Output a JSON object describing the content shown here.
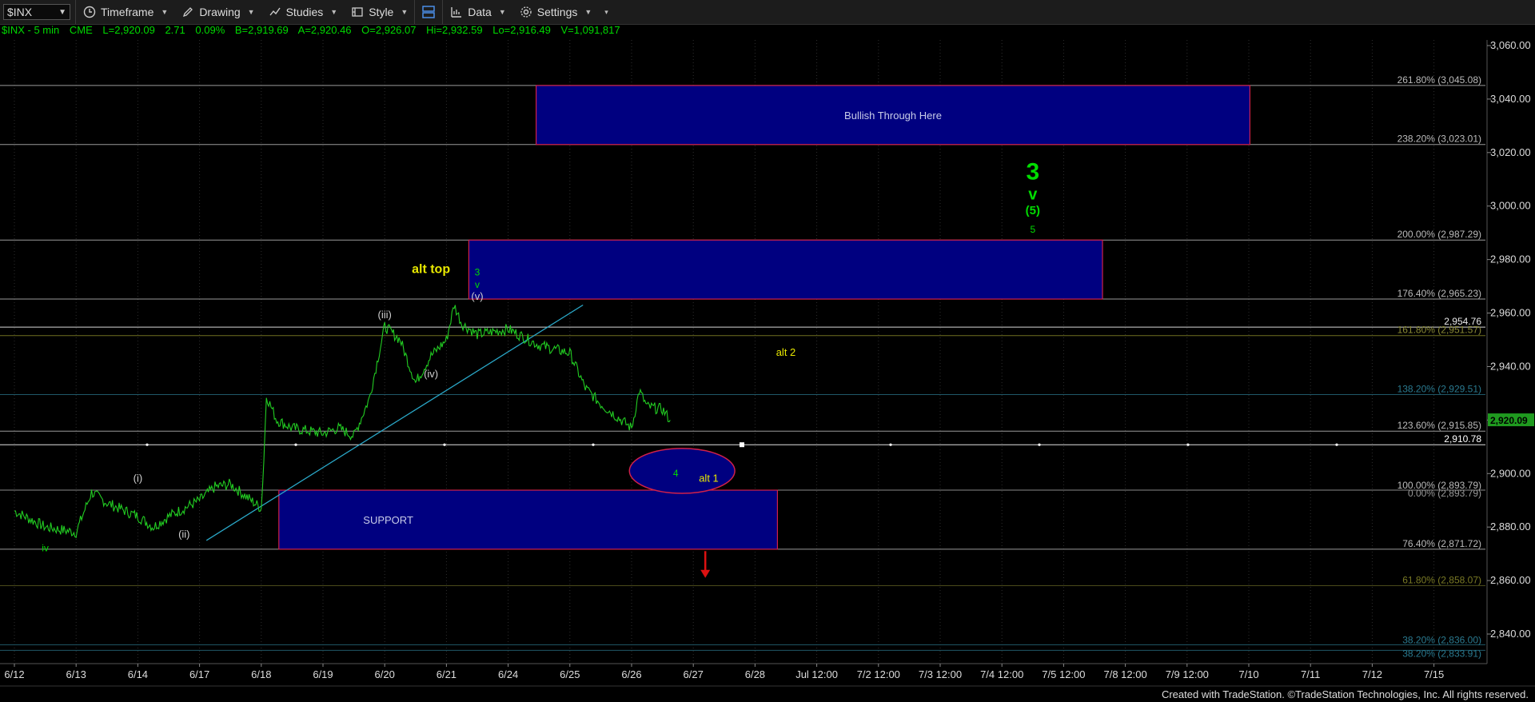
{
  "toolbar": {
    "symbol": "$INX",
    "timeframe": "Timeframe",
    "drawing": "Drawing",
    "studies": "Studies",
    "style": "Style",
    "data": "Data",
    "settings": "Settings"
  },
  "quote": {
    "name": "$INX - 5 min",
    "exchange": "CME",
    "last": "L=2,920.09",
    "change": "2.71",
    "pct": "0.09%",
    "bid": "B=2,919.69",
    "ask": "A=2,920.46",
    "open": "O=2,926.07",
    "high": "Hi=2,932.59",
    "low": "Lo=2,916.49",
    "volume": "V=1,091,817"
  },
  "colors": {
    "price": "#22cc22",
    "box_fill": "#000080",
    "box_border": "#d0204a",
    "trendline": "#2aa8c8",
    "up_text": "#00dd00",
    "alt_text": "#e8e800",
    "down_arrow": "#dd1111"
  },
  "footer": "Created with TradeStation. ©TradeStation Technologies, Inc. All rights reserved.",
  "chart_data": {
    "type": "line",
    "title": "$INX - 5 min",
    "xlabel": "",
    "ylabel": "",
    "x_tick_labels": [
      "6/12",
      "6/13",
      "6/14",
      "6/17",
      "6/18",
      "6/19",
      "6/20",
      "6/21",
      "6/24",
      "6/25",
      "6/26",
      "6/27",
      "6/28",
      "Jul 12:00",
      "7/2 12:00",
      "7/3 12:00",
      "7/4 12:00",
      "7/5 12:00",
      "7/8 12:00",
      "7/9 12:00",
      "7/10",
      "7/11",
      "7/12",
      "7/15"
    ],
    "y_tick_labels": [
      "3,060.00",
      "3,040.00",
      "3,020.00",
      "3,000.00",
      "2,980.00",
      "2,960.00",
      "2,940.00",
      "2,920.00",
      "2,900.00",
      "2,880.00",
      "2,860.00",
      "2,840.00"
    ],
    "ylim": [
      2830,
      3065
    ],
    "grid": false,
    "last_price": "2,920.09",
    "series": [
      {
        "x": [
          "6/12",
          "6/12 12:00",
          "6/13",
          "6/13 06:00",
          "6/13 12:00",
          "6/14",
          "6/14 06:00",
          "6/14 12:00",
          "6/17",
          "6/17 06:00",
          "6/17 12:00",
          "6/18",
          "6/18 01:00",
          "6/18 02:00",
          "6/18 06:00",
          "6/18 12:00",
          "6/19",
          "6/19 06:00",
          "6/19 12:00",
          "6/19 18:00",
          "6/20",
          "6/20 06:00",
          "6/20 12:00",
          "6/20 18:00",
          "6/21",
          "6/21 03:00",
          "6/21 06:00",
          "6/21 12:00",
          "6/24",
          "6/24 06:00",
          "6/24 12:00",
          "6/25",
          "6/25 06:00",
          "6/25 12:00",
          "6/26",
          "6/26 03:00",
          "6/26 06:00",
          "6/26 12:00",
          "6/26 15:00"
        ],
        "values": [
          2886,
          2880,
          2878,
          2893,
          2889,
          2884,
          2880,
          2884,
          2890,
          2895,
          2896,
          2887,
          2905,
          2929,
          2920,
          2917,
          2915,
          2917,
          2914,
          2928,
          2955,
          2950,
          2934,
          2944,
          2950,
          2963,
          2956,
          2952,
          2954,
          2951,
          2948,
          2945,
          2932,
          2926,
          2917,
          2931,
          2925,
          2924,
          2920
        ]
      }
    ],
    "levels": [
      {
        "label": "261.80% (3,045.08)",
        "value": 3045.08
      },
      {
        "label": "238.20% (3,023.01)",
        "value": 3023.01
      },
      {
        "label": "200.00% (2,987.29)",
        "value": 2987.29
      },
      {
        "label": "176.40% (2,965.23)",
        "value": 2965.23
      },
      {
        "label": "2,954.76",
        "value": 2954.76
      },
      {
        "label": "161.80% (2,951.57)",
        "value": 2951.57
      },
      {
        "label": "138.20% (2,929.51)",
        "value": 2929.51
      },
      {
        "label": "123.60% (2,915.85)",
        "value": 2915.85
      },
      {
        "label": "2,910.78",
        "value": 2910.78
      },
      {
        "label": "100.00% (2,893.79)",
        "value": 2893.79
      },
      {
        "label": "0.00% (2,893.79)",
        "value": 2893.79
      },
      {
        "label": "76.40% (2,871.72)",
        "value": 2871.72
      },
      {
        "label": "61.80% (2,858.07)",
        "value": 2858.07
      },
      {
        "label": "38.20% (2,836.00)",
        "value": 2836.0
      },
      {
        "label": "38.20% (2,833.91)",
        "value": 2833.91
      }
    ],
    "zones": [
      {
        "label": "Bullish Through Here",
        "x": [
          "6/24",
          "7/9 12:00"
        ],
        "y": [
          3023.01,
          3045.08
        ]
      },
      {
        "label": "",
        "x": [
          "6/21",
          "7/5 12:00"
        ],
        "y": [
          2965.23,
          2987.29
        ]
      },
      {
        "label": "SUPPORT",
        "x": [
          "6/18",
          "6/28"
        ],
        "y": [
          2871.72,
          2893.79
        ]
      }
    ],
    "ellipse": {
      "label": "4",
      "center": [
        "6/27",
        2901
      ],
      "rx_days": 0.7,
      "ry": 8
    },
    "trendline": {
      "from": [
        "6/17 12:00",
        2875
      ],
      "to": [
        "6/24 12:00",
        2963
      ]
    },
    "annotations": [
      {
        "text": "iv",
        "x": "6/12 12:00",
        "y": 2871,
        "role": "green-small"
      },
      {
        "text": "(i)",
        "x": "6/14",
        "y": 2897,
        "role": "white"
      },
      {
        "text": "(ii)",
        "x": "6/14 18:00",
        "y": 2876,
        "role": "white"
      },
      {
        "text": "(iii)",
        "x": "6/20",
        "y": 2958,
        "role": "white"
      },
      {
        "text": "(iv)",
        "x": "6/20 18:00",
        "y": 2936,
        "role": "white"
      },
      {
        "text": "(v)",
        "x": "6/21 12:00",
        "y": 2965,
        "role": "white"
      },
      {
        "text": "v",
        "x": "6/21 12:00",
        "y": 2969.5,
        "role": "green-small"
      },
      {
        "text": "3",
        "x": "6/21 12:00",
        "y": 2974,
        "role": "green-small"
      },
      {
        "text": "alt top",
        "x": "6/20 18:00",
        "y": 2975,
        "role": "yellow-bold"
      },
      {
        "text": "alt 2",
        "x": "6/28 12:00",
        "y": 2944,
        "role": "yellow"
      },
      {
        "text": "alt 1",
        "x": "6/27 06:00",
        "y": 2897,
        "role": "yellow"
      },
      {
        "text": "5",
        "x": "7/4 12:00",
        "y": 2990,
        "role": "green-small"
      },
      {
        "text": "(5)",
        "x": "7/4 12:00",
        "y": 2997,
        "role": "green-mid"
      },
      {
        "text": "v",
        "x": "7/4 12:00",
        "y": 3002.5,
        "role": "green-big"
      },
      {
        "text": "3",
        "x": "7/4 12:00",
        "y": 3010,
        "role": "green-huge"
      }
    ],
    "down_arrow": {
      "x": "6/27",
      "y_from": 2871,
      "y_to": 2861
    }
  }
}
